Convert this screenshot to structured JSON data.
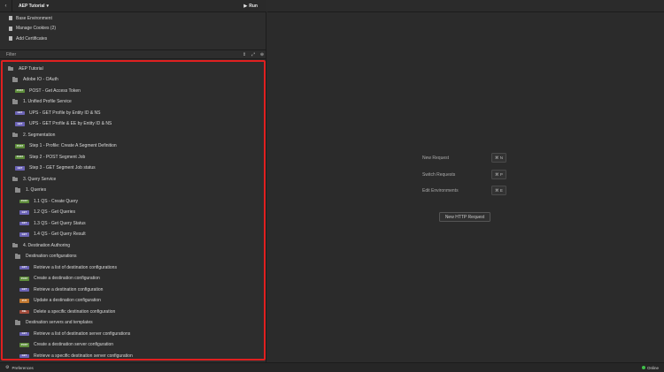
{
  "header": {
    "workspace_name": "AEP Tutorial",
    "run_label": "Run"
  },
  "env_menu": [
    {
      "label": "Base Environment"
    },
    {
      "label": "Manage Cookies (2)"
    },
    {
      "label": "Add Certificates"
    }
  ],
  "filter": {
    "placeholder": "Filter"
  },
  "tree": [
    {
      "type": "folder",
      "depth": 0,
      "label": "AEP Tutorial"
    },
    {
      "type": "folder",
      "depth": 1,
      "label": "Adobe IO - OAuth"
    },
    {
      "type": "request",
      "depth": 2,
      "method": "POST",
      "label": "POST - Get Access Token"
    },
    {
      "type": "folder",
      "depth": 1,
      "label": "1. Unified Profile Service"
    },
    {
      "type": "request",
      "depth": 2,
      "method": "GET",
      "label": "UPS - GET Profile by Entity ID & NS"
    },
    {
      "type": "request",
      "depth": 2,
      "method": "GET",
      "label": "UPS - GET Profile & EE by Entity ID & NS"
    },
    {
      "type": "folder",
      "depth": 1,
      "label": "2. Segmentation"
    },
    {
      "type": "request",
      "depth": 2,
      "method": "POST",
      "label": "Step 1 - Profile: Create A Segment Definition"
    },
    {
      "type": "request",
      "depth": 2,
      "method": "POST",
      "label": "Step 2 - POST Segment Job"
    },
    {
      "type": "request",
      "depth": 2,
      "method": "GET",
      "label": "Step 3 - GET Segment Job status"
    },
    {
      "type": "folder",
      "depth": 1,
      "label": "3. Query Service"
    },
    {
      "type": "folder",
      "depth": 2,
      "label": "1. Queries"
    },
    {
      "type": "request",
      "depth": 3,
      "method": "POST",
      "label": "1.1 QS - Create Query"
    },
    {
      "type": "request",
      "depth": 3,
      "method": "GET",
      "label": "1.2 QS - Get Queries"
    },
    {
      "type": "request",
      "depth": 3,
      "method": "GET",
      "label": "1.3 QS - Get Query Status"
    },
    {
      "type": "request",
      "depth": 3,
      "method": "GET",
      "label": "1.4 QS - Get Query Result"
    },
    {
      "type": "folder",
      "depth": 1,
      "label": "4. Destination Authoring"
    },
    {
      "type": "folder",
      "depth": 2,
      "label": "Destination configurations"
    },
    {
      "type": "request",
      "depth": 3,
      "method": "GET",
      "label": "Retrieve a list of destination configurations"
    },
    {
      "type": "request",
      "depth": 3,
      "method": "POST",
      "label": "Create a destination configuration"
    },
    {
      "type": "request",
      "depth": 3,
      "method": "GET",
      "label": "Retrieve a destination configuration"
    },
    {
      "type": "request",
      "depth": 3,
      "method": "PUT",
      "label": "Update a destination configuration"
    },
    {
      "type": "request",
      "depth": 3,
      "method": "DEL",
      "label": "Delete a specific destination configuration"
    },
    {
      "type": "folder",
      "depth": 2,
      "label": "Destination servers and templates"
    },
    {
      "type": "request",
      "depth": 3,
      "method": "GET",
      "label": "Retrieve a list of destination server configurations"
    },
    {
      "type": "request",
      "depth": 3,
      "method": "POST",
      "label": "Create a destination server configuration"
    },
    {
      "type": "request",
      "depth": 3,
      "method": "GET",
      "label": "Retrieve a specific destination server configuration"
    }
  ],
  "shortcuts": [
    {
      "label": "New Request",
      "key": "⌘ N"
    },
    {
      "label": "Switch Requests",
      "key": "⌘ P"
    },
    {
      "label": "Edit Environments",
      "key": "⌘ E"
    }
  ],
  "new_http_request_label": "New HTTP Request",
  "status_bar": {
    "preferences_label": "Preferences",
    "online_label": "Online"
  },
  "colors": {
    "highlight_border": "#e02020",
    "post": "#5d8c3a",
    "get": "#6b63b5",
    "put": "#c0772f",
    "del": "#a24b3a",
    "online": "#3fbf4a"
  },
  "icons": {
    "back": "chevron-left-icon",
    "run": "play-icon",
    "env": "document-icon",
    "folder": "folder-icon",
    "preferences": "gear-icon"
  }
}
